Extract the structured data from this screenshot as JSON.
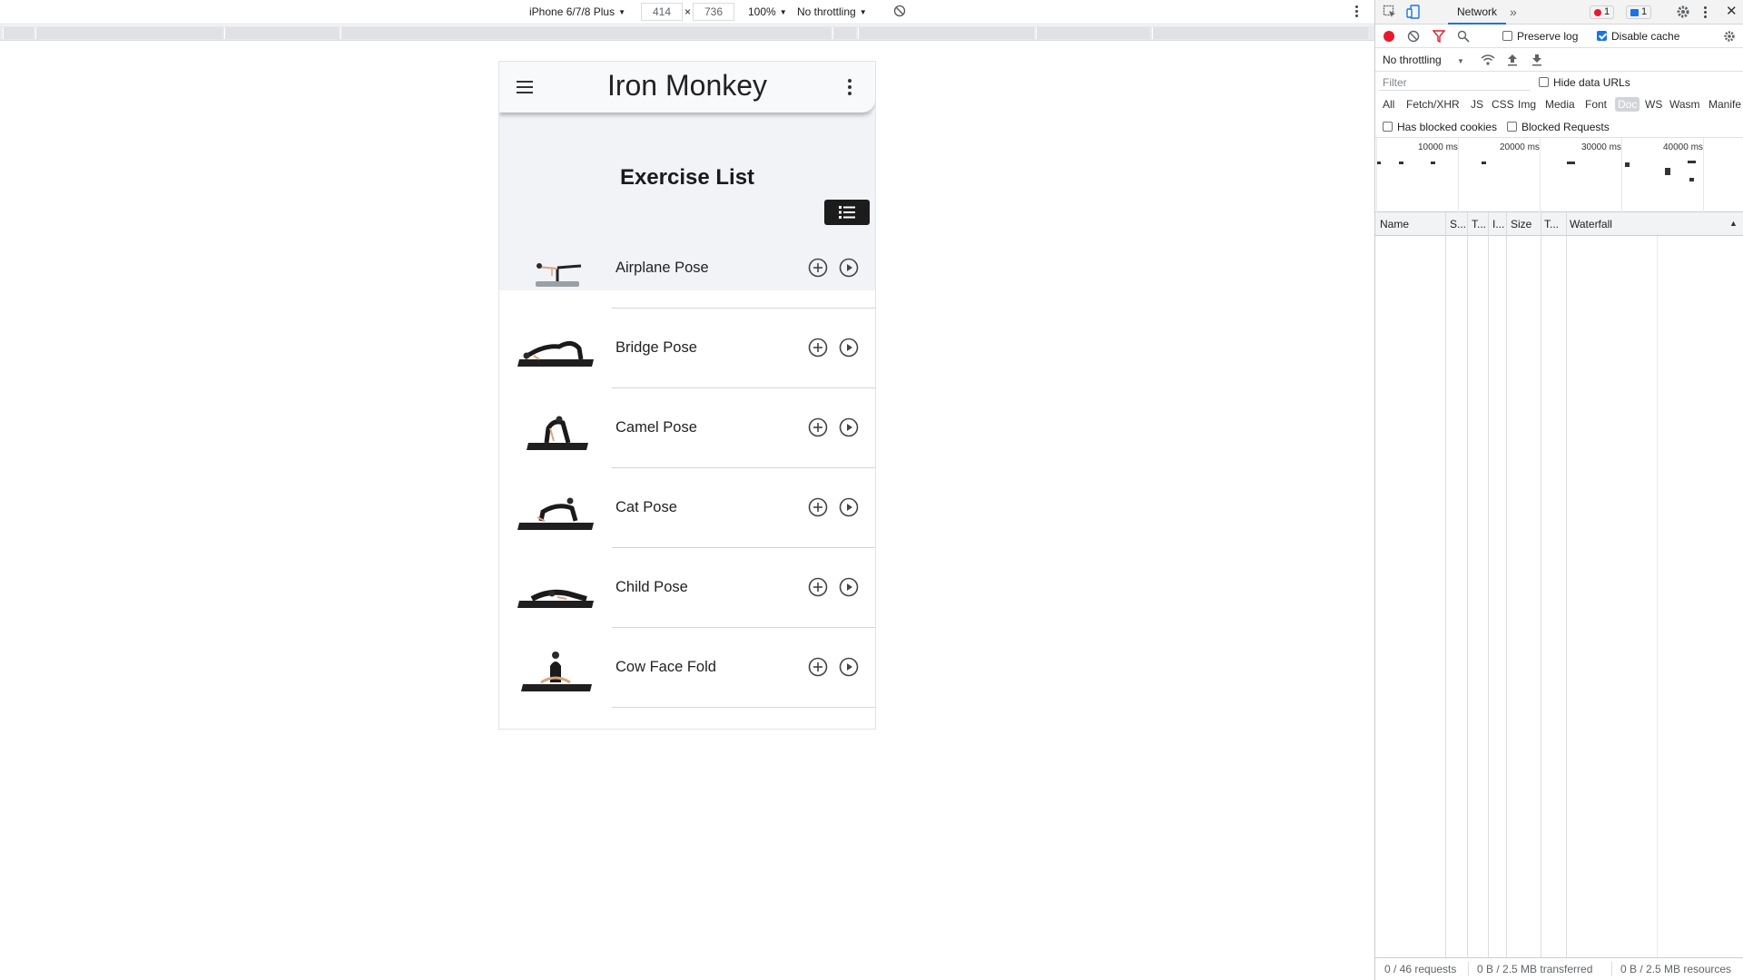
{
  "device_toolbar": {
    "device": "iPhone 6/7/8 Plus",
    "width": "414",
    "times": "×",
    "height": "736",
    "zoom": "100%",
    "throttling": "No throttling"
  },
  "app": {
    "title": "Iron Monkey",
    "list_title": "Exercise List",
    "exercises": [
      {
        "name": "Airplane Pose"
      },
      {
        "name": "Bridge Pose"
      },
      {
        "name": "Camel Pose"
      },
      {
        "name": "Cat Pose"
      },
      {
        "name": "Child Pose"
      },
      {
        "name": "Cow Face Fold"
      }
    ]
  },
  "devtools": {
    "tab": "Network",
    "more_tabs": "»",
    "errors": "1",
    "messages": "1",
    "preserve_log": "Preserve log",
    "disable_cache": "Disable cache",
    "throttling": "No throttling",
    "filter_placeholder": "Filter",
    "hide_data_urls": "Hide data URLs",
    "types": [
      "All",
      "Fetch/XHR",
      "JS",
      "CSS",
      "Img",
      "Media",
      "Font",
      "Doc",
      "WS",
      "Wasm",
      "Manife"
    ],
    "selected_type": "Doc",
    "has_blocked_cookies": "Has blocked cookies",
    "blocked_requests": "Blocked Requests",
    "timeline_ticks": [
      "10000 ms",
      "20000 ms",
      "30000 ms",
      "40000 ms"
    ],
    "columns": [
      "Name",
      "S...",
      "T...",
      "I...",
      "Size",
      "T...",
      "Waterfall"
    ],
    "status": {
      "requests": "0 / 46 requests",
      "transferred": "0 B / 2.5 MB transferred",
      "resources": "0 B / 2.5 MB resources"
    }
  },
  "colors": {
    "accent": "#1a73e8",
    "record": "#e8192c",
    "app_bar": "#f8f9fb",
    "list_header": "#f1f3f7"
  }
}
